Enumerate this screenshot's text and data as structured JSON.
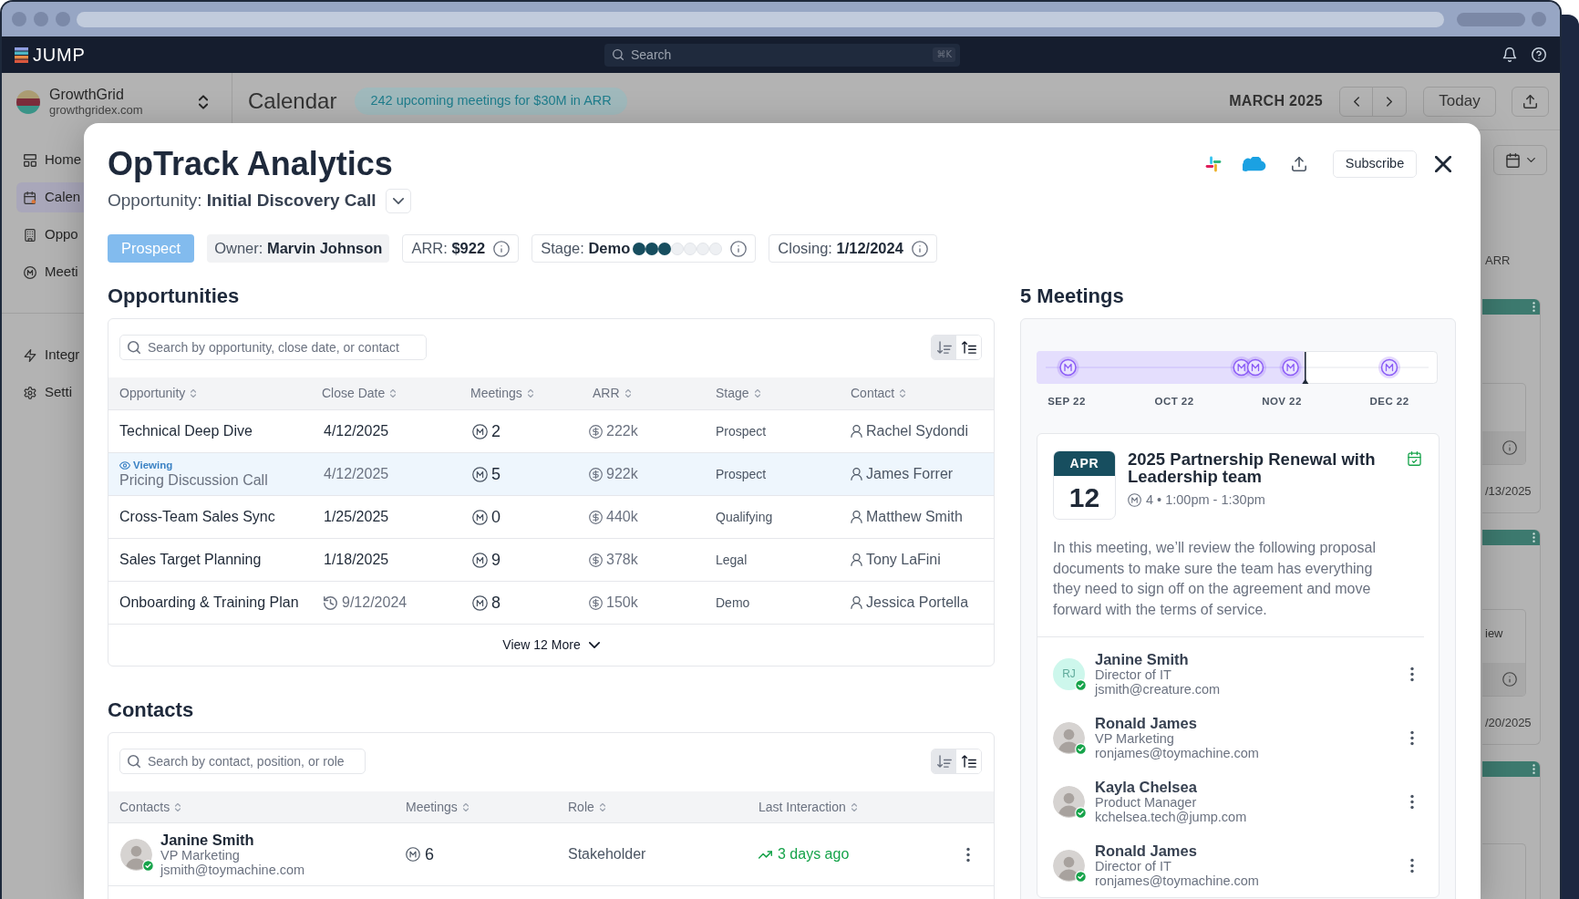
{
  "app_header": {
    "logo_text": "JUMP",
    "search": {
      "placeholder": "Search",
      "shortcut": "⌘K"
    }
  },
  "sidebar": {
    "workspace": {
      "name": "GrowthGrid",
      "domain": "growthgridex.com"
    },
    "items": [
      {
        "label": "Home",
        "selected": false
      },
      {
        "label": "Calen",
        "selected": true
      },
      {
        "label": "Oppo",
        "selected": false
      },
      {
        "label": "Meeti",
        "selected": false
      }
    ],
    "secondary_items": [
      {
        "label": "Integr",
        "selected": false
      },
      {
        "label": "Setti",
        "selected": false
      }
    ]
  },
  "calendar_header": {
    "title": "Calendar",
    "summary": "242 upcoming meetings for $30M in ARR",
    "month": "MARCH 2025",
    "today_button": "Today"
  },
  "board": {
    "column_heading": "ARR",
    "cards": [
      {
        "kind": "info",
        "date": "/13/2025"
      },
      {
        "kind": "info",
        "label": "iew",
        "date": "/20/2025"
      },
      {
        "kind": "cut"
      }
    ]
  },
  "modal": {
    "title": "OpTrack Analytics",
    "subtitle": "Opportunity: **Initial Discovery Call**",
    "subscribe_button": "Subscribe",
    "status": "Prospect",
    "facts": [
      {
        "kind": "plain",
        "text": "Owner: **Marvin Johnson**"
      },
      {
        "kind": "info",
        "text": "ARR: **$922**"
      },
      {
        "kind": "stage",
        "text": "Stage: **Demo**",
        "dots": [
          {
            "filled": true
          },
          {
            "filled": true
          },
          {
            "filled": true
          },
          {
            "filled": false
          },
          {
            "filled": false
          },
          {
            "filled": false
          },
          {
            "filled": false
          }
        ]
      },
      {
        "kind": "info",
        "text": "Closing: **1/12/2024**"
      }
    ],
    "opportunities": {
      "heading": "Opportunities",
      "search_placeholder": "Search by opportunity, close date, or contact",
      "sort_buttons": [
        {
          "selected": true
        },
        {
          "selected": false
        }
      ],
      "columns": [
        "Opportunity",
        "Close Date",
        "Meetings",
        "ARR",
        "Stage",
        "Contact"
      ],
      "viewing_label": "Viewing",
      "rows": [
        {
          "name": "Technical Deep Dive",
          "viewing": false,
          "close_date": "4/12/2025",
          "overdue": false,
          "meetings": "2",
          "arr": "222k",
          "stage": "Prospect",
          "contact": "Rachel Sydondi"
        },
        {
          "name": "Pricing Discussion Call",
          "viewing": true,
          "close_date": "4/12/2025",
          "overdue": false,
          "meetings": "5",
          "arr": "922k",
          "stage": "Prospect",
          "contact": "James Forrer"
        },
        {
          "name": "Cross-Team Sales Sync",
          "viewing": false,
          "close_date": "1/25/2025",
          "overdue": false,
          "meetings": "0",
          "arr": "440k",
          "stage": "Qualifying",
          "contact": "Matthew Smith"
        },
        {
          "name": "Sales Target Planning",
          "viewing": false,
          "close_date": "1/18/2025",
          "overdue": false,
          "meetings": "9",
          "arr": "378k",
          "stage": "Legal",
          "contact": "Tony LaFini"
        },
        {
          "name": "Onboarding & Training Plan",
          "viewing": false,
          "close_date": "9/12/2024",
          "overdue": true,
          "meetings": "8",
          "arr": "150k",
          "stage": "Demo",
          "contact": "Jessica Portella"
        }
      ],
      "more_button": "View 12 More"
    },
    "contacts": {
      "heading": "Contacts",
      "search_placeholder": "Search by contact, position, or role",
      "sort_buttons": [
        {
          "selected": true
        },
        {
          "selected": false
        }
      ],
      "columns": [
        "Contacts",
        "Meetings",
        "Role",
        "Last Interaction"
      ],
      "rows": [
        {
          "name": "Janine Smith",
          "title": "VP Marketing",
          "email": "jsmith@toymachine.com",
          "avatar": {
            "kind": "photo"
          },
          "verified": true,
          "meetings": "6",
          "role": "Stakeholder",
          "last_interaction": "3 days ago"
        }
      ]
    },
    "meetings": {
      "heading": "5 Meetings",
      "timeline": {
        "level": 0.67,
        "month_labels": [
          "SEP 22",
          "OCT 22",
          "NOV 22",
          "DEC 22"
        ]
      },
      "meeting": {
        "month": "APR",
        "day": "12",
        "title": "2025 Partnership Renewal with Leadership team",
        "confirmed": true,
        "details": "4 • 1:00pm - 1:30pm",
        "description": "In this meeting, we’ll review the following proposal documents to make sure the team has everything they need to sign off on the agreement and move forward with the terms of service.",
        "attendees": [
          {
            "name": "Janine Smith",
            "title": "Director of IT",
            "email": "jsmith@creature.com",
            "avatar": {
              "kind": "initials",
              "initials": "RJ"
            },
            "verified": true
          },
          {
            "name": "Ronald James",
            "title": "VP Marketing",
            "email": "ronjames@toymachine.com",
            "avatar": {
              "kind": "photo"
            },
            "verified": true
          },
          {
            "name": "Kayla Chelsea",
            "title": "Product Manager",
            "email": "kchelsea.tech@jump.com",
            "avatar": {
              "kind": "photo"
            },
            "verified": true
          },
          {
            "name": "Ronald James",
            "title": "Director of IT",
            "email": "ronjames@toymachine.com",
            "avatar": {
              "kind": "photo"
            },
            "verified": true
          }
        ]
      }
    }
  }
}
